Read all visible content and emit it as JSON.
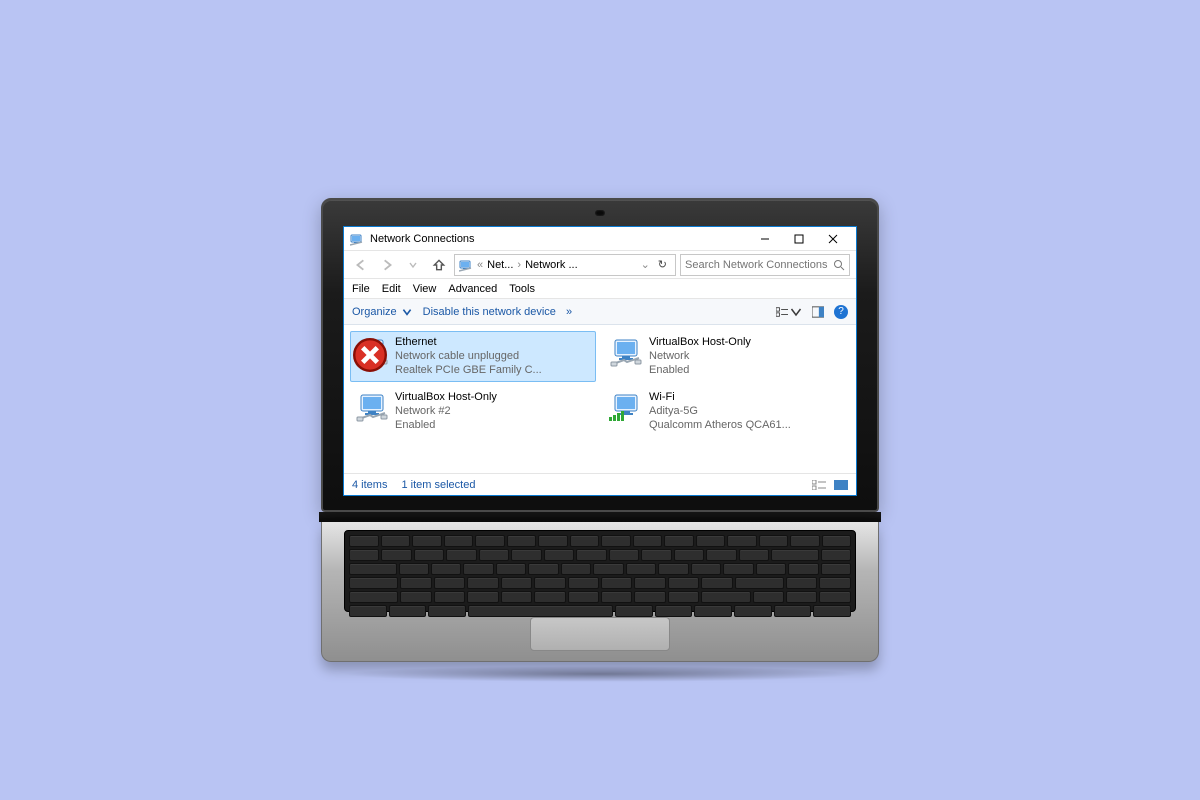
{
  "window": {
    "title": "Network Connections",
    "controls": {
      "min": "minimize",
      "max": "maximize",
      "close": "close"
    }
  },
  "nav": {
    "back": "Back",
    "forward": "Forward",
    "up": "Up",
    "breadcrumb_prefix": "«",
    "breadcrumb_1": "Net...",
    "breadcrumb_2": "Network ...",
    "refresh": "Refresh"
  },
  "search": {
    "placeholder": "Search Network Connections"
  },
  "menus": [
    "File",
    "Edit",
    "View",
    "Advanced",
    "Tools"
  ],
  "cmdbar": {
    "organize": "Organize",
    "disable": "Disable this network device",
    "more": "»",
    "view_btn": "View",
    "preview_btn": "Preview pane",
    "help": "?"
  },
  "connections": [
    {
      "id": "ethernet",
      "name": "Ethernet",
      "status": "Network cable unplugged",
      "detail": "Realtek PCIe GBE Family C...",
      "selected": true,
      "unplugged": true,
      "kind": "eth"
    },
    {
      "id": "vbox1",
      "name": "VirtualBox Host-Only",
      "status": "Network",
      "detail": "Enabled",
      "selected": false,
      "kind": "eth"
    },
    {
      "id": "vbox2",
      "name": "VirtualBox Host-Only",
      "status": "Network #2",
      "detail": "Enabled",
      "selected": false,
      "kind": "eth"
    },
    {
      "id": "wifi",
      "name": "Wi-Fi",
      "status": "Aditya-5G",
      "detail": "Qualcomm Atheros QCA61...",
      "selected": false,
      "kind": "wifi"
    }
  ],
  "statusbar": {
    "items": "4 items",
    "selected": "1 item selected"
  }
}
